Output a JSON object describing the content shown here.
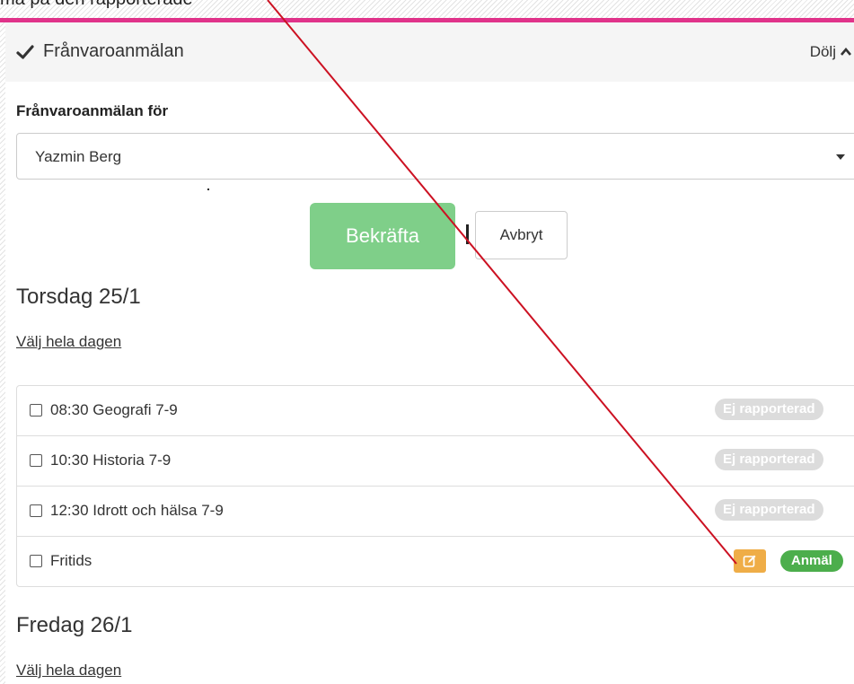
{
  "top_caption": "ma på den rapporterade",
  "panel": {
    "title": "Frånvaroanmälan",
    "hide_label": "Dölj"
  },
  "form": {
    "label": "Frånvaroanmälan för",
    "selected_student": "Yazmin Berg"
  },
  "actions": {
    "confirm_label": "Bekräfta",
    "cancel_label": "Avbryt"
  },
  "days": [
    {
      "heading": "Torsdag 25/1",
      "select_all_label": "Välj hela dagen",
      "lessons": [
        {
          "text": "08:30 Geografi 7-9",
          "status": "Ej rapporterad"
        },
        {
          "text": "10:30 Historia 7-9",
          "status": "Ej rapporterad"
        },
        {
          "text": "12:30 Idrott och hälsa 7-9",
          "status": "Ej rapporterad"
        },
        {
          "text": "Fritids",
          "status": "Anmäl"
        }
      ]
    },
    {
      "heading": "Fredag 26/1",
      "select_all_label": "Välj hela dagen"
    }
  ],
  "colors": {
    "accent_pink": "#e0338a",
    "confirm_green": "#7fcf89",
    "status_gray": "#dcdcdc",
    "edit_orange": "#efad47",
    "report_green": "#4cae4c",
    "annotation_red": "#cc1122"
  },
  "icons": {
    "panel": "check-icon",
    "hide": "caret-up-icon",
    "select": "caret-down-icon",
    "edit": "edit-icon"
  }
}
